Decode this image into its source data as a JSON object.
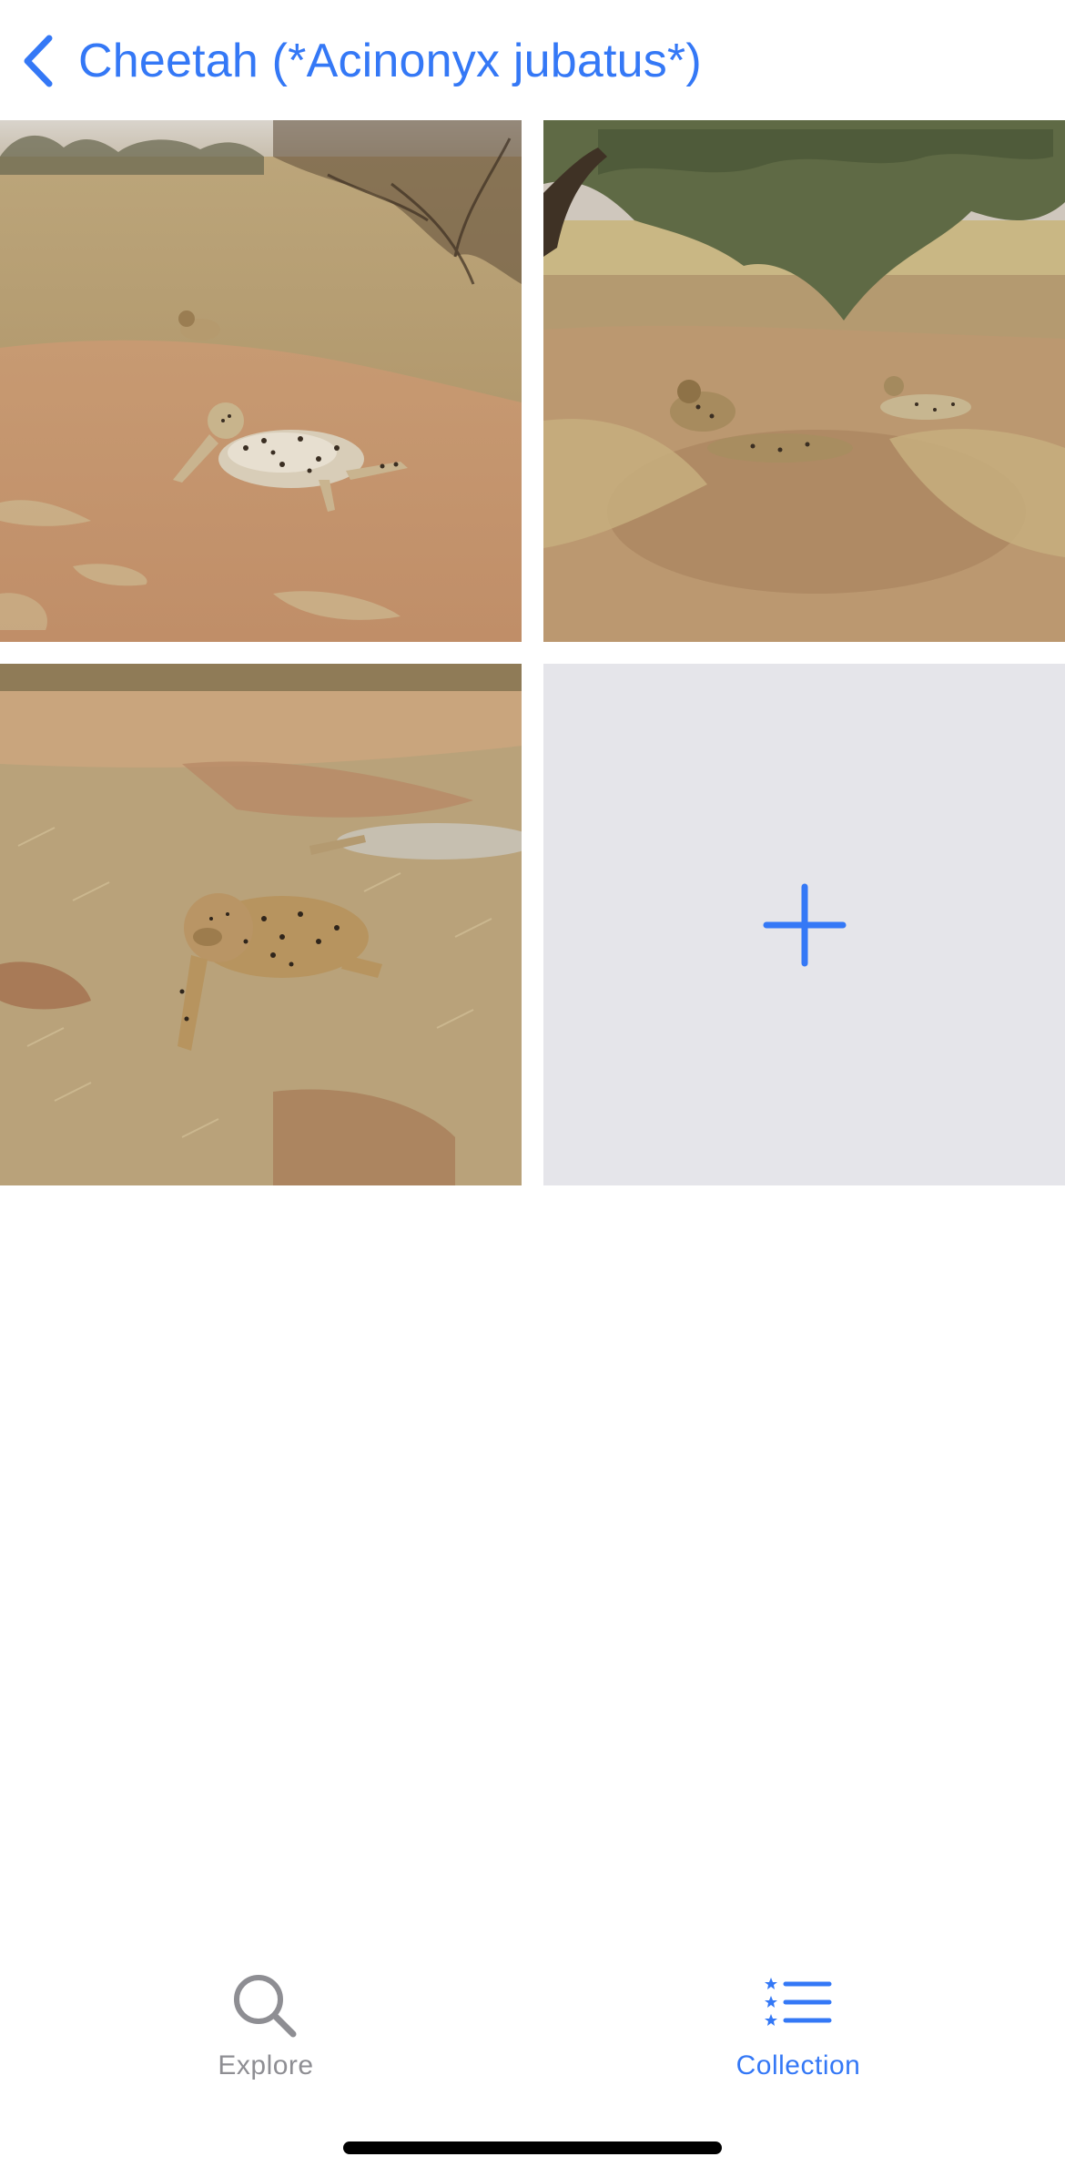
{
  "header": {
    "title": "Cheetah (*Acinonyx jubatus*)",
    "back_icon": "chevron-left-icon"
  },
  "grid": {
    "photos": [
      {
        "name": "photo-1",
        "description": "cheetah lying on dirt road"
      },
      {
        "name": "photo-2",
        "description": "cheetahs resting under tree"
      },
      {
        "name": "photo-3",
        "description": "cheetah lying in dry grass"
      }
    ],
    "add_tile": {
      "icon": "plus-icon"
    }
  },
  "tab_bar": {
    "tabs": [
      {
        "label": "Explore",
        "icon": "search-icon",
        "selected": false
      },
      {
        "label": "Collection",
        "icon": "starred-list-icon",
        "selected": true
      }
    ]
  },
  "colors": {
    "accent": "#3478f6",
    "inactive": "#8e8e93",
    "placeholder": "#e5e5ea",
    "background": "#ffffff"
  }
}
